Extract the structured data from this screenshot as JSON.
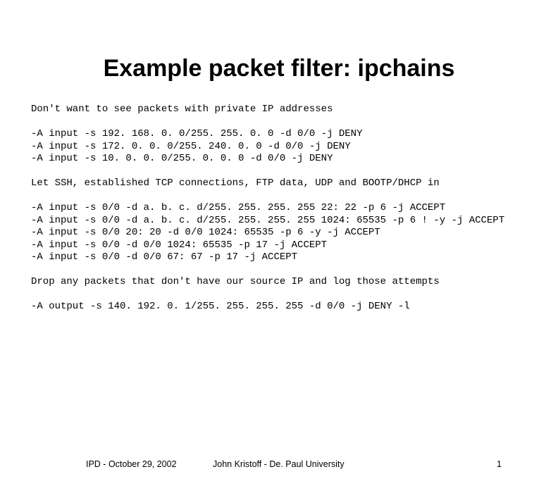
{
  "title": "Example packet filter: ipchains",
  "lines": [
    "Don't want to see packets with private IP addresses",
    "",
    "-A input -s 192. 168. 0. 0/255. 255. 0. 0 -d 0/0 -j DENY",
    "-A input -s 172. 0. 0. 0/255. 240. 0. 0 -d 0/0 -j DENY",
    "-A input -s 10. 0. 0. 0/255. 0. 0. 0 -d 0/0 -j DENY",
    "",
    "Let SSH, established TCP connections, FTP data, UDP and BOOTP/DHCP in",
    "",
    "-A input -s 0/0 -d a. b. c. d/255. 255. 255. 255 22: 22 -p 6 -j ACCEPT",
    "-A input -s 0/0 -d a. b. c. d/255. 255. 255. 255 1024: 65535 -p 6 ! -y -j ACCEPT",
    "-A input -s 0/0 20: 20 -d 0/0 1024: 65535 -p 6 -y -j ACCEPT",
    "-A input -s 0/0 -d 0/0 1024: 65535 -p 17 -j ACCEPT",
    "-A input -s 0/0 -d 0/0 67: 67 -p 17 -j ACCEPT",
    "",
    "Drop any packets that don't have our source IP and log those attempts",
    "",
    "-A output -s 140. 192. 0. 1/255. 255. 255. 255 -d 0/0 -j DENY -l"
  ],
  "footer": {
    "left": "IPD - October 29, 2002",
    "center": "John Kristoff - De. Paul University",
    "page": "1"
  }
}
